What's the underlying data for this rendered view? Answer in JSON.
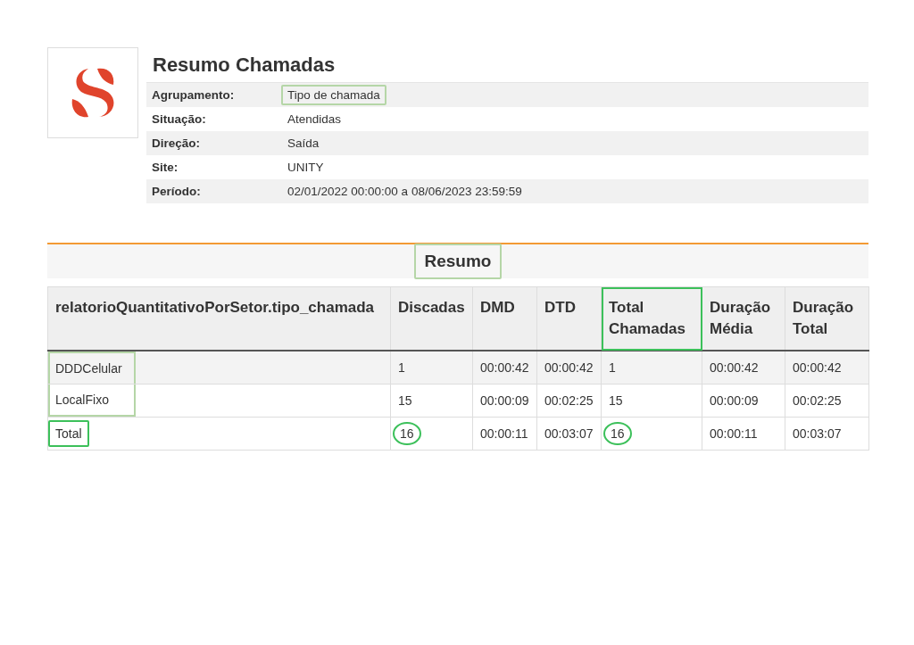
{
  "report": {
    "title": "Resumo Chamadas",
    "filters": [
      {
        "label": "Agrupamento:",
        "value": "Tipo de chamada",
        "boxed": true,
        "color": "#b5d6a7"
      },
      {
        "label": "Situação:",
        "value": "Atendidas",
        "boxed": false
      },
      {
        "label": "Direção:",
        "value": "Saída",
        "boxed": false
      },
      {
        "label": "Site:",
        "value": "UNITY",
        "boxed": false
      },
      {
        "label": "Período:",
        "value": "02/01/2022 00:00:00 a 08/06/2023 23:59:59",
        "boxed": false
      }
    ]
  },
  "section": {
    "title": "Resumo",
    "boxed": true,
    "color": "#b5d6a7"
  },
  "table": {
    "columns": [
      {
        "label": "relatorioQuantitativoPorSetor.tipo_chamada",
        "boxed": false
      },
      {
        "label": "Discadas",
        "boxed": false
      },
      {
        "label": "DMD",
        "boxed": false
      },
      {
        "label": "DTD",
        "boxed": false
      },
      {
        "label": "Total Chamadas",
        "boxed": true,
        "color": "#3cc05a"
      },
      {
        "label": "Duração Média",
        "boxed": false
      },
      {
        "label": "Duração Total",
        "boxed": false
      }
    ],
    "rows": [
      {
        "cells": [
          {
            "text": "DDDCelular",
            "boxed": true,
            "circled": false,
            "color": "#b5d6a7"
          },
          {
            "text": "1",
            "boxed": false,
            "circled": false
          },
          {
            "text": "00:00:42",
            "boxed": false,
            "circled": false
          },
          {
            "text": "00:00:42",
            "boxed": false,
            "circled": false
          },
          {
            "text": "1",
            "boxed": false,
            "circled": false
          },
          {
            "text": "00:00:42",
            "boxed": false,
            "circled": false
          },
          {
            "text": "00:00:42",
            "boxed": false,
            "circled": false
          }
        ]
      },
      {
        "cells": [
          {
            "text": "LocalFixo",
            "boxed": true,
            "circled": false,
            "color": "#b5d6a7"
          },
          {
            "text": "15",
            "boxed": false,
            "circled": false
          },
          {
            "text": "00:00:09",
            "boxed": false,
            "circled": false
          },
          {
            "text": "00:02:25",
            "boxed": false,
            "circled": false
          },
          {
            "text": "15",
            "boxed": false,
            "circled": false
          },
          {
            "text": "00:00:09",
            "boxed": false,
            "circled": false
          },
          {
            "text": "00:02:25",
            "boxed": false,
            "circled": false
          }
        ]
      },
      {
        "cells": [
          {
            "text": "Total",
            "boxed": true,
            "circled": false,
            "color": "#3cc05a"
          },
          {
            "text": "16",
            "boxed": false,
            "circled": true,
            "color": "#3cc05a"
          },
          {
            "text": "00:00:11",
            "boxed": false,
            "circled": false
          },
          {
            "text": "00:03:07",
            "boxed": false,
            "circled": false
          },
          {
            "text": "16",
            "boxed": false,
            "circled": true,
            "color": "#3cc05a"
          },
          {
            "text": "00:00:11",
            "boxed": false,
            "circled": false
          },
          {
            "text": "00:03:07",
            "boxed": false,
            "circled": false
          }
        ]
      }
    ]
  }
}
